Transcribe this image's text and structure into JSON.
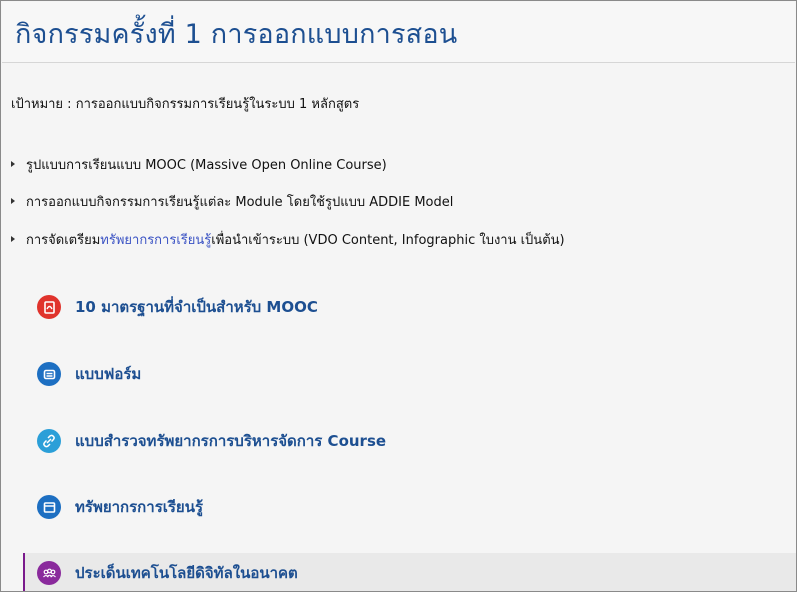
{
  "section": {
    "title": "กิจกรรมครั้งที่ 1 การออกแบบการสอน",
    "goal": "เป้าหมาย : การออกแบบกิจกรรมการเรียนรู้ในระบบ 1 หลักสูตร"
  },
  "bullets": [
    {
      "text": "รูปแบบการเรียนแบบ MOOC (Massive Open Online Course)"
    },
    {
      "text": "การออกแบบกิจกรรมการเรียนรู้แต่ละ Module โดยใช้รูปแบบ ADDIE Model"
    },
    {
      "prefix": "การจัดเตรียม",
      "link": "ทรัพยากรการเรียนรู้",
      "suffix": "เพื่อนำเข้าระบบ (VDO Content, Infographic ใบงาน เป็นต้น)"
    }
  ],
  "activities": [
    {
      "label": "10 มาตรฐานที่จำเป็นสำหรับ MOOC",
      "icon": "pdf-icon",
      "color": "#e0332c"
    },
    {
      "label": "แบบฟอร์ม",
      "icon": "form-icon",
      "color": "#1d6fc2"
    },
    {
      "label": "แบบสำรวจทรัพยากรการบริหารจัดการ Course",
      "icon": "url-link-icon",
      "color": "#2b9fd8"
    },
    {
      "label": "ทรัพยากรการเรียนรู้",
      "icon": "resource-icon",
      "color": "#1d6fc2"
    },
    {
      "label": "ประเด็นเทคโนโลยีดิจิทัลในอนาคต",
      "icon": "forum-icon",
      "color": "#8a2a9c"
    }
  ],
  "colors": {
    "title": "#1d4f91",
    "link": "#3b53c4",
    "highlight_border": "#7a1a8c"
  }
}
